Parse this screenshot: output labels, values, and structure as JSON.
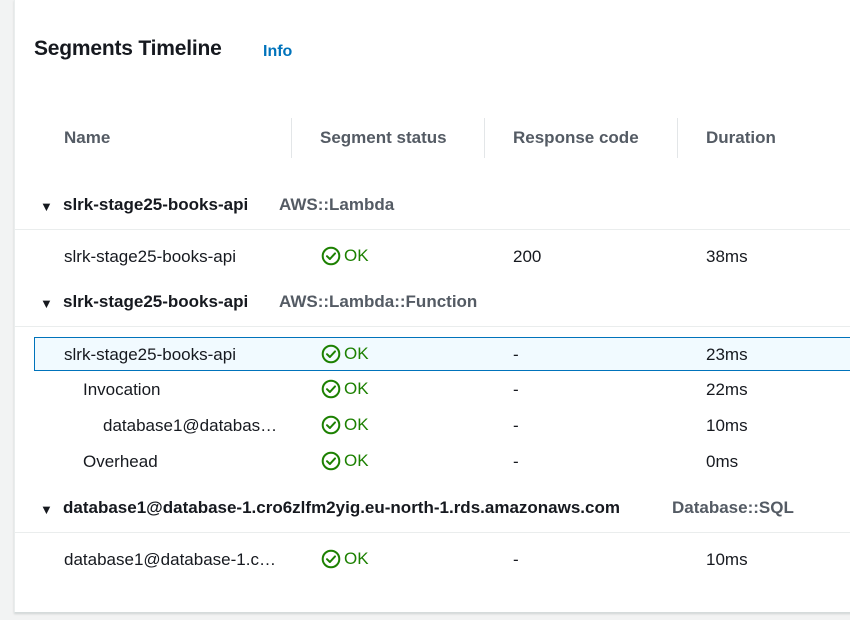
{
  "header": {
    "title": "Segments Timeline",
    "info_link": "Info"
  },
  "columns": [
    "Name",
    "Segment status",
    "Response code",
    "Duration"
  ],
  "groups": [
    {
      "name": "slrk-stage25-books-api",
      "type": "AWS::Lambda",
      "rows": [
        {
          "name": "slrk-stage25-books-api",
          "status": "OK",
          "code": "200",
          "duration": "38ms"
        }
      ]
    },
    {
      "name": "slrk-stage25-books-api",
      "type": "AWS::Lambda::Function",
      "rows": [
        {
          "name": "slrk-stage25-books-api",
          "status": "OK",
          "code": "-",
          "duration": "23ms",
          "selected": true
        },
        {
          "name": "Invocation",
          "status": "OK",
          "code": "-",
          "duration": "22ms"
        },
        {
          "name": "database1@databas…",
          "status": "OK",
          "code": "-",
          "duration": "10ms"
        },
        {
          "name": "Overhead",
          "status": "OK",
          "code": "-",
          "duration": "0ms"
        }
      ]
    },
    {
      "name": "database1@database-1.cro6zlfm2yig.eu-north-1.rds.amazonaws.com",
      "type": "Database::SQL",
      "rows": [
        {
          "name": "database1@database-1.c…",
          "status": "OK",
          "code": "-",
          "duration": "10ms"
        }
      ]
    }
  ],
  "colors": {
    "ok": "#1d8102",
    "link": "#0073bb",
    "selected_bg": "#f1faff",
    "selected_border": "#0073bb"
  },
  "icons": {
    "expand": "caret-down-icon",
    "status_ok": "check-circle-icon"
  }
}
